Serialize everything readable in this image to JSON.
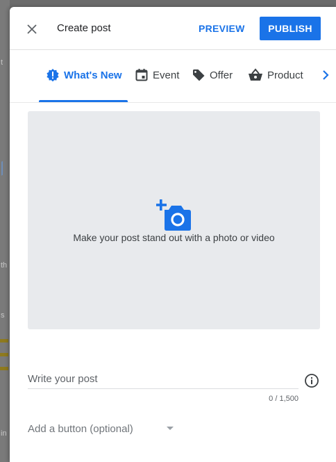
{
  "background": {
    "fragments": [
      "t",
      "th",
      "s",
      "in"
    ]
  },
  "header": {
    "title": "Create post",
    "preview_label": "PREVIEW",
    "publish_label": "PUBLISH"
  },
  "tabs": [
    {
      "label": "What's New",
      "icon": "alert-badge-icon",
      "active": true
    },
    {
      "label": "Event",
      "icon": "calendar-icon",
      "active": false
    },
    {
      "label": "Offer",
      "icon": "tag-icon",
      "active": false
    },
    {
      "label": "Product",
      "icon": "shopping-basket-icon",
      "active": false
    }
  ],
  "media": {
    "prompt": "Make your post stand out with a photo or video",
    "icon": "add-photo-icon"
  },
  "post": {
    "placeholder": "Write your post",
    "counter": "0 / 1,500"
  },
  "add_button": {
    "label": "Add a button (optional)"
  },
  "colors": {
    "accent": "#1a73e8",
    "media_bg": "#e8eaed"
  }
}
